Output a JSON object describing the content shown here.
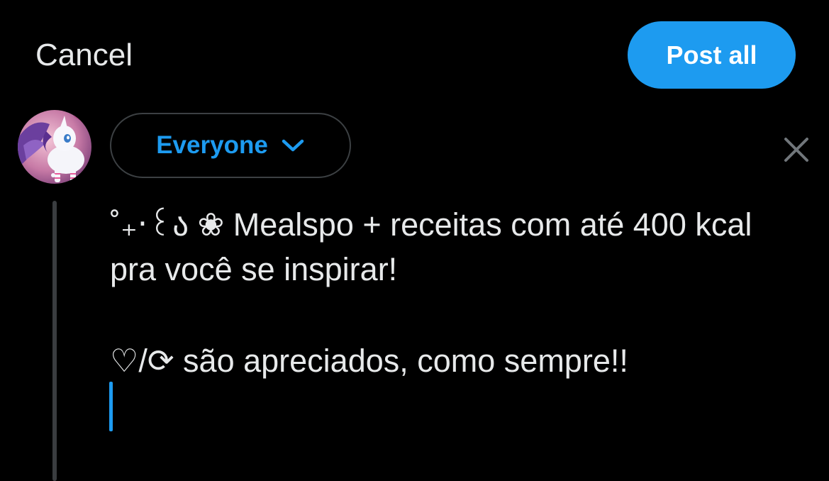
{
  "header": {
    "cancel_label": "Cancel",
    "post_all_label": "Post all"
  },
  "composer": {
    "audience_label": "Everyone",
    "text_line1": "˚₊‧꒰ა ❀ Mealspo + receitas com até 400 kcal pra você se inspirar!",
    "text_line2": "♡/⟳ são apreciados, como sempre!!"
  },
  "icons": {
    "audience_chevron": "chevron-down-icon",
    "remove_post": "close-icon",
    "avatar": "avatar"
  },
  "colors": {
    "background": "#000000",
    "accent": "#1d9bf0",
    "text": "#e7e9ea",
    "muted": "#71767b",
    "border": "#3c4043"
  }
}
